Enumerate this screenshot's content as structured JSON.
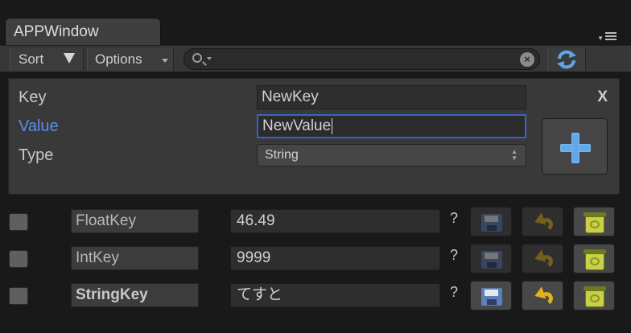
{
  "window": {
    "tab_title": "APPWindow"
  },
  "toolbar": {
    "sort_label": "Sort",
    "options_label": "Options",
    "search_value": ""
  },
  "editor": {
    "key_label": "Key",
    "value_label": "Value",
    "type_label": "Type",
    "key_value": "NewKey",
    "value_value": "NewValue",
    "type_selected": "String",
    "close_label": "X"
  },
  "rows": [
    {
      "key": "FloatKey",
      "value": "46.49",
      "help": "?",
      "bold": false,
      "modified": false
    },
    {
      "key": "IntKey",
      "value": "9999",
      "help": "?",
      "bold": false,
      "modified": false
    },
    {
      "key": "StringKey",
      "value": "てすと",
      "help": "?",
      "bold": true,
      "modified": true
    }
  ],
  "colors": {
    "accent_blue": "#5b8ce8",
    "focus_border": "#3a62c6",
    "plus_icon": "#62a7e8",
    "undo_icon": "#e1b21e",
    "trash_icon": "#c9d046"
  },
  "icons": {
    "search": "search-icon",
    "clear": "clear-icon",
    "refresh": "refresh-icon",
    "add": "plus-icon",
    "save": "floppy-disk-icon",
    "undo": "undo-arrow-icon",
    "delete": "trash-can-icon"
  }
}
